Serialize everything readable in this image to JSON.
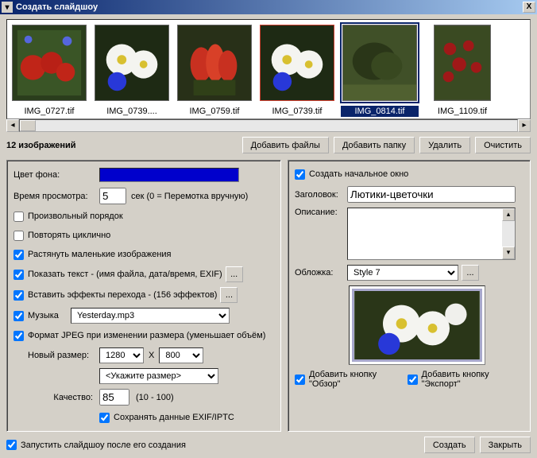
{
  "window": {
    "title": "Создать слайдшоу",
    "close": "X"
  },
  "thumbs": [
    {
      "label": "IMG_0727.tif"
    },
    {
      "label": "IMG_0739...."
    },
    {
      "label": "IMG_0759.tif"
    },
    {
      "label": "IMG_0739.tif"
    },
    {
      "label": "IMG_0814.tif"
    },
    {
      "label": "IMG_1109.tif"
    }
  ],
  "count_text": "12 изображений",
  "buttons": {
    "add_files": "Добавить файлы",
    "add_folder": "Добавить папку",
    "delete": "Удалить",
    "clear": "Очистить",
    "create": "Создать",
    "close": "Закрыть"
  },
  "left": {
    "bg_color_label": "Цвет фона:",
    "bg_color": "#0000cc",
    "view_time_label": "Время просмотра:",
    "view_time": "5",
    "view_time_suffix": "сек (0 = Перемотка вручную)",
    "random": "Произвольный порядок",
    "loop": "Повторять циклично",
    "stretch": "Растянуть маленькие изображения",
    "show_text": "Показать текст - (имя файла, дата/время, EXIF)",
    "effects": "Вставить эффекты перехода - (156 эффектов)",
    "music": "Музыка",
    "music_file": "Yesterday.mp3",
    "jpeg": "Формат JPEG при изменении размера (уменьшает объём)",
    "new_size_label": "Новый размер:",
    "width": "1280",
    "height": "800",
    "size_x": "X",
    "size_preset": "<Укажите размер>",
    "quality_label": "Качество:",
    "quality": "85",
    "quality_range": "(10 - 100)",
    "keep_exif": "Сохранять данные EXIF/IPTC",
    "ellipsis": "..."
  },
  "right": {
    "create_start": "Создать начальное окно",
    "title_label": "Заголовок:",
    "title_value": "Лютики-цветочки",
    "desc_label": "Описание:",
    "cover_label": "Обложка:",
    "style_value": "Style 7",
    "add_browse": "Добавить кнопку \"Обзор\"",
    "add_export": "Добавить кнопку \"Экспорт\""
  },
  "footer": {
    "run_after": "Запустить слайдшоу после его создания"
  }
}
